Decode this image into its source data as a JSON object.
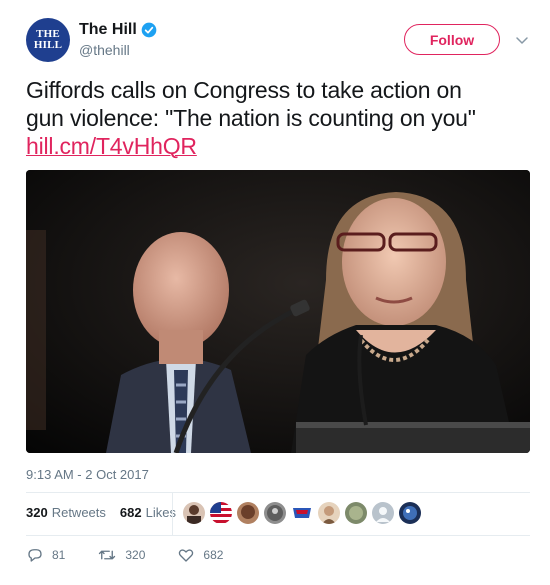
{
  "account": {
    "logo_line1": "THE",
    "logo_line2": "HILL",
    "display_name": "The Hill",
    "handle": "@thehill",
    "verified": true
  },
  "follow_button": {
    "label": "Follow"
  },
  "tweet": {
    "text_line1": "Giffords calls on Congress to take action on",
    "text_line2": "gun violence: \"The nation is counting on you\"",
    "link": "hill.cm/T4vHhQR",
    "timestamp": "9:13 AM - 2 Oct 2017"
  },
  "stats": {
    "retweets_count": "320",
    "retweets_label": "Retweets",
    "likes_count": "682",
    "likes_label": "Likes"
  },
  "likers": [
    "avatar-1",
    "avatar-flag",
    "avatar-3",
    "avatar-4",
    "avatar-5",
    "avatar-6",
    "avatar-7",
    "avatar-8",
    "avatar-9",
    "avatar-10"
  ],
  "actions": {
    "reply_count": "81",
    "retweet_count": "320",
    "like_count": "682"
  },
  "colors": {
    "accent": "#e0245e",
    "muted": "#657786",
    "verified": "#1da1f2"
  }
}
